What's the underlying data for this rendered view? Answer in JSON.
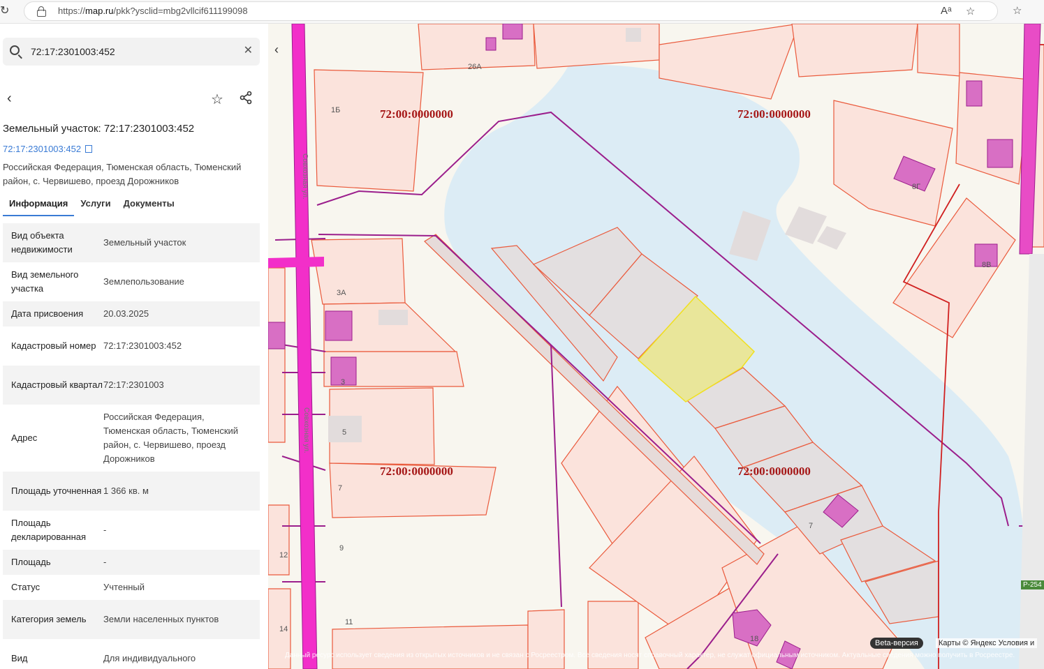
{
  "browser": {
    "url_prefix": "https://",
    "url_host": "map.ru",
    "url_path": "/pkk?ysclid=mbg2vllcif611199098"
  },
  "search": {
    "value": "72:17:2301003:452"
  },
  "object": {
    "title": "Земельный участок: 72:17:2301003:452",
    "cad_link": "72:17:2301003:452",
    "address": "Российская Федерация, Тюменская область, Тюменский район, с. Червишево, проезд Дорожников"
  },
  "tabs": [
    "Информация",
    "Услуги",
    "Документы"
  ],
  "properties": [
    {
      "key": "Вид объекта недвижимости",
      "value": "Земельный участок"
    },
    {
      "key": "Вид земельного участка",
      "value": "Землепользование"
    },
    {
      "key": "Дата присвоения",
      "value": "20.03.2025"
    },
    {
      "key": "Кадастровый номер",
      "value": "72:17:2301003:452"
    },
    {
      "key": "Кадастровый квартал",
      "value": "72:17:2301003"
    },
    {
      "key": "Адрес",
      "value": "Российская Федерация, Тюменская область, Тюменский район, с. Червишево, проезд Дорожников"
    },
    {
      "key": "Площадь уточненная",
      "value": "1 366 кв. м"
    },
    {
      "key": "Площадь декларированная",
      "value": "-"
    },
    {
      "key": "Площадь",
      "value": "-"
    },
    {
      "key": "Статус",
      "value": "Учтенный"
    },
    {
      "key": "Категория земель",
      "value": "Земли населенных пунктов"
    },
    {
      "key": "Вид",
      "value": "Для индивидуального"
    }
  ],
  "map": {
    "quarter_labels": [
      "72:00:0000000",
      "72:00:0000000",
      "72:00:0000000",
      "72:00:0000000"
    ],
    "building_numbers": [
      "26А",
      "1Б",
      "3А",
      "3",
      "5",
      "7",
      "9",
      "11",
      "12",
      "14",
      "8Г",
      "8В",
      "7",
      "18"
    ],
    "road_label_1": "Совхозная ул.",
    "road_label_2": "Совхозная ул.",
    "route_sign": "Р-254",
    "beta_badge": "Beta-версия",
    "copyright": "Карты © Яндекс   Условия и",
    "disclaimer": "Данный ресурс использует сведения из открытых источников и не связан с Росреестром. Все сведения носят справочный характер, не служат официальным источником. Актуальные сведения можно получить в Росреестре."
  },
  "colors": {
    "accent": "#3a7bd5",
    "parcel_fill": "#fbe3dc",
    "parcel_stroke": "#ea5a3c",
    "selected_fill": "#e9e69a",
    "selected_stroke": "#f0e020",
    "water": "#dcecf5",
    "boundary": "#9b1e8c",
    "building": "#d86fc4"
  }
}
